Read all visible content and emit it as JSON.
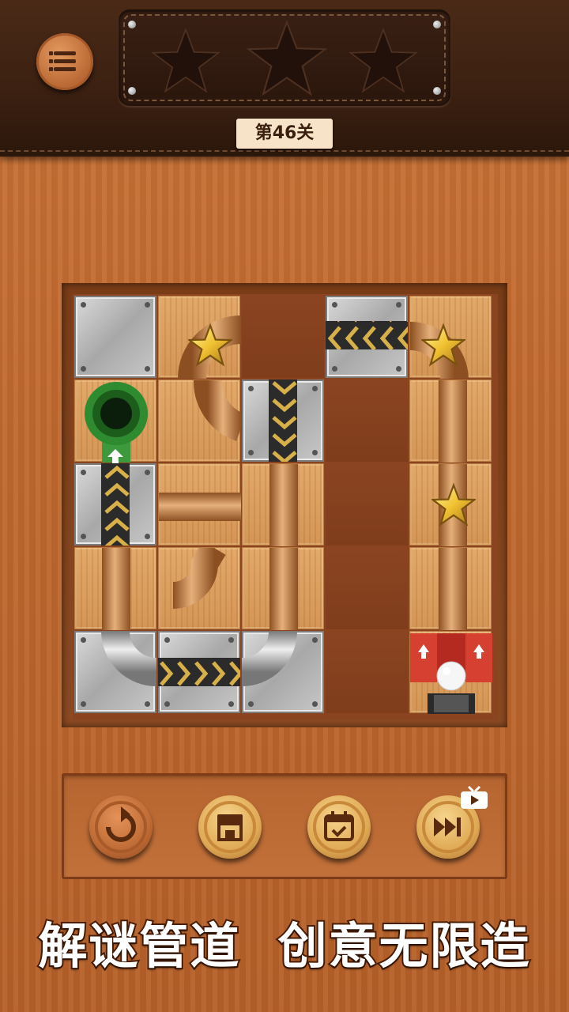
{
  "header": {
    "menu_icon": "list-icon",
    "stars_earned": 0,
    "stars_total": 3,
    "level_label": "第46关"
  },
  "board": {
    "rows": 5,
    "cols": 5,
    "tiles": [
      [
        "metal-block",
        "wood-curve-star",
        "empty",
        "metal-arrow-left",
        "wood-curve-star"
      ],
      [
        "wood-start-hole",
        "wood-curve",
        "metal-arrow-down",
        "empty",
        "wood-straight-vertical"
      ],
      [
        "metal-arrow-up",
        "wood-straight-horizontal",
        "wood-straight-vertical",
        "empty",
        "wood-straight-star"
      ],
      [
        "wood-straight-vertical",
        "wood-curve",
        "wood-straight-vertical",
        "empty",
        "wood-straight-vertical"
      ],
      [
        "metal-curve",
        "metal-arrow-right",
        "metal-curve",
        "empty",
        "wood-ball-launcher"
      ]
    ],
    "stars_on_board": 3
  },
  "controls": {
    "restart_icon": "restart-icon",
    "shop_icon": "shop-icon",
    "daily_icon": "calendar-check-icon",
    "skip_icon": "fast-forward-icon",
    "video_badge_icon": "tv-icon"
  },
  "slogan": "解谜管道  创意无限造",
  "colors": {
    "header_bg": "#3b2011",
    "wood_tile": "#d99b5c",
    "metal_tile": "#c0c0c0",
    "start_hole": "#2f8b2f",
    "launcher_red": "#d64030",
    "star_gold": "#f1c232"
  }
}
